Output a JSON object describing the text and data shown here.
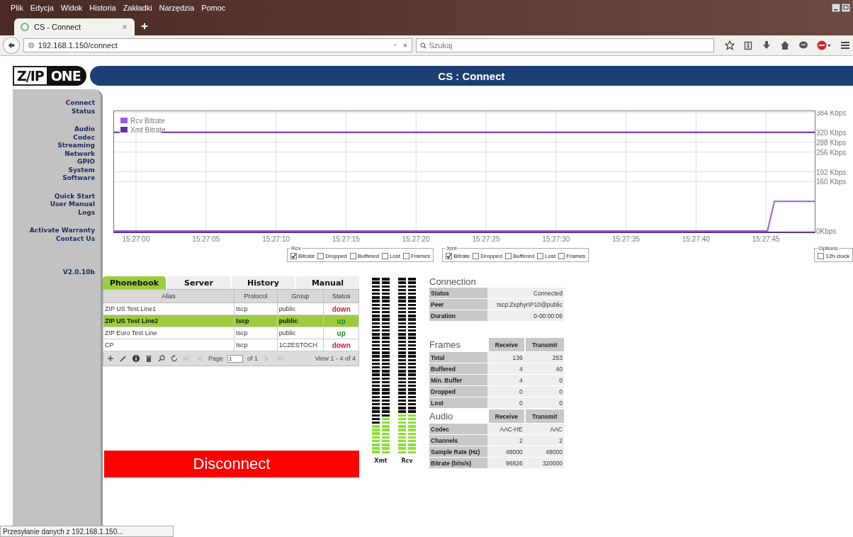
{
  "browser": {
    "menu": [
      "Plik",
      "Edycja",
      "Widok",
      "Historia",
      "Zakładki",
      "Narzędzia",
      "Pomoc"
    ],
    "tab_title": "CS - Connect",
    "url": "192.168.1.150/connect",
    "search_placeholder": "Szukaj",
    "status_bar": "Przesyłanie danych z 192.168.1.150..."
  },
  "logo": {
    "left": "Z/IP",
    "right": "ONE"
  },
  "header": {
    "title": "CS : Connect"
  },
  "sidebar": {
    "groups": [
      {
        "items": [
          "Connect",
          "Status"
        ]
      },
      {
        "items": [
          "Audio",
          "Codec",
          "Streaming",
          "Network",
          "GPIO",
          "System",
          "Software"
        ]
      },
      {
        "items": [
          "Quick Start",
          "User Manual",
          "Logs"
        ]
      },
      {
        "items": [
          "Activate Warranty",
          "Contact Us"
        ]
      }
    ],
    "version": "V2.0.10b"
  },
  "chart_data": {
    "type": "line",
    "grid": true,
    "legend": "upper left",
    "x": [
      55618.4,
      55665.1,
      55665.6,
      55668.48
    ],
    "xlim": [
      55618.38,
      55668.48
    ],
    "ylim": [
      0,
      384
    ],
    "series": [
      {
        "name": "Rcv Bitrate",
        "color": "#9b59e6",
        "values": [
          0,
          0,
          96,
          96
        ]
      },
      {
        "name": "Xmt Bitrate",
        "color": "#6a2ca8",
        "values": [
          320,
          320,
          320,
          320
        ]
      }
    ],
    "xticks": [
      {
        "value": 55620,
        "label": "15:27:00"
      },
      {
        "value": 55625,
        "label": "15:27:05"
      },
      {
        "value": 55630,
        "label": "15:27:10"
      },
      {
        "value": 55635,
        "label": "15:27:15"
      },
      {
        "value": 55640,
        "label": "15:27:20"
      },
      {
        "value": 55645,
        "label": "15:27:25"
      },
      {
        "value": 55650,
        "label": "15:27:30"
      },
      {
        "value": 55655,
        "label": "15:27:35"
      },
      {
        "value": 55660,
        "label": "15:27:40"
      },
      {
        "value": 55665,
        "label": "15:27:45"
      }
    ],
    "yticks": [
      {
        "value": 0,
        "label": "0Kbps"
      },
      {
        "value": 160,
        "label": "160 Kbps"
      },
      {
        "value": 192,
        "label": "192 Kbps"
      },
      {
        "value": 256,
        "label": "256 Kbps"
      },
      {
        "value": 288,
        "label": "288 Kbps"
      },
      {
        "value": 320,
        "label": "320 Kbps"
      },
      {
        "value": 384,
        "label": "384 Kbps"
      }
    ]
  },
  "filters": [
    {
      "legend": "Rcv",
      "options": [
        {
          "label": "Bitrate",
          "checked": true
        },
        {
          "label": "Dropped",
          "checked": false
        },
        {
          "label": "Buffered",
          "checked": false
        },
        {
          "label": "Lost",
          "checked": false
        },
        {
          "label": "Frames",
          "checked": false
        }
      ]
    },
    {
      "legend": "Xmt",
      "options": [
        {
          "label": "Bitrate",
          "checked": true
        },
        {
          "label": "Dropped",
          "checked": false
        },
        {
          "label": "Buffered",
          "checked": false
        },
        {
          "label": "Lost",
          "checked": false
        },
        {
          "label": "Frames",
          "checked": false
        }
      ]
    }
  ],
  "options": {
    "legend": "Options",
    "items": [
      {
        "label": "12h clock",
        "checked": false
      }
    ]
  },
  "phonebook": {
    "tabs": [
      {
        "label": "Phonebook",
        "selected": true
      },
      {
        "label": "Server",
        "selected": false
      },
      {
        "label": "History",
        "selected": false
      },
      {
        "label": "Manual",
        "selected": false
      }
    ],
    "columns": [
      "Alias",
      "Protocol",
      "Group",
      "Status"
    ],
    "rows": [
      {
        "alias": "ZIP US Test Line1",
        "protocol": "tscp",
        "group": "public",
        "status": "down",
        "color": "#d0202a",
        "selected": false
      },
      {
        "alias": "ZIP US Test Line2",
        "protocol": "tscp",
        "group": "public",
        "status": "up",
        "color": "#208a20",
        "selected": true
      },
      {
        "alias": "ZIP Euro Test Line",
        "protocol": "tscp",
        "group": "public",
        "status": "up",
        "color": "#208a20",
        "selected": false
      },
      {
        "alias": "CP",
        "protocol": "tscp",
        "group": "1CZESTOCH",
        "status": "down",
        "color": "#d0202a",
        "selected": false
      }
    ],
    "pager": {
      "page_label": "Page",
      "page": "1",
      "of": "of 1",
      "view": "View 1 - 4 of 4"
    }
  },
  "disconnect": "Disconnect",
  "meters": [
    {
      "label": "Xmt",
      "channels": [
        {
          "level": 0.16
        },
        {
          "level": 0.2
        }
      ]
    },
    {
      "label": "Rcv",
      "channels": [
        {
          "level": 0.22
        },
        {
          "level": 0.22
        }
      ]
    }
  ],
  "connection": {
    "title": "Connection",
    "rows": [
      {
        "label": "Status",
        "value": "Connected"
      },
      {
        "label": "Peer",
        "value": "tscp:ZephyrIP10@public"
      },
      {
        "label": "Duration",
        "value": "0-00:00:06"
      }
    ]
  },
  "frames": {
    "title": "Frames",
    "columns": [
      "Receive",
      "Transmit"
    ],
    "rows": [
      {
        "label": "Total",
        "values": [
          "136",
          "253"
        ]
      },
      {
        "label": "Buffered",
        "values": [
          "4",
          "40"
        ]
      },
      {
        "label": "Min. Buffer",
        "values": [
          "4",
          "0"
        ]
      },
      {
        "label": "Dropped",
        "values": [
          "0",
          "0"
        ]
      },
      {
        "label": "Lost",
        "values": [
          "0",
          "0"
        ]
      }
    ]
  },
  "audio": {
    "title": "Audio",
    "columns": [
      "Receive",
      "Transmit"
    ],
    "rows": [
      {
        "label": "Codec",
        "values": [
          "AAC-HE",
          "AAC"
        ]
      },
      {
        "label": "Channels",
        "values": [
          "2",
          "2"
        ]
      },
      {
        "label": "Sample Rate (Hz)",
        "values": [
          "48000",
          "48000"
        ]
      },
      {
        "label": "Bitrate (bits/s)",
        "values": [
          "96826",
          "320000"
        ]
      }
    ]
  }
}
